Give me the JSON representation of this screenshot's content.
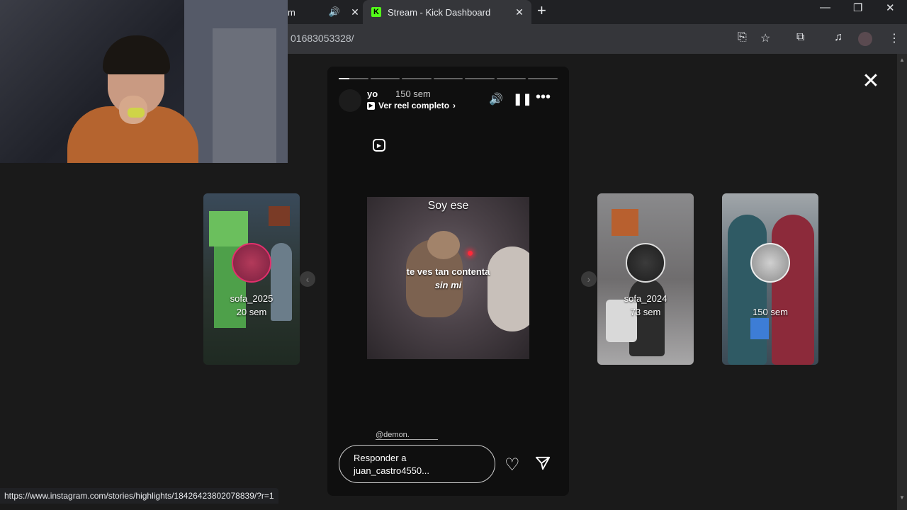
{
  "browser": {
    "tabs": [
      {
        "title": "m",
        "active": false
      },
      {
        "title": "Stream - Kick Dashboard",
        "active": true
      }
    ],
    "url": "01683053328/",
    "status_url": "https://www.instagram.com/stories/highlights/18426423802078839/?r=1"
  },
  "story": {
    "username": "yo",
    "time": "150 sem",
    "reel_link": "Ver reel completo",
    "media_text_top": "Soy ese",
    "media_text_line1": "te ves tan contenta",
    "media_text_line2": "sin mi",
    "mention": "@demon.",
    "reply_line1": "Responder a",
    "reply_line2": "juan_castro4550..."
  },
  "previews": [
    {
      "name": "sofa_2025",
      "time": "20 sem"
    },
    {
      "name": "sofa_2024",
      "time": "73 sem"
    },
    {
      "name": "",
      "time": "150 sem"
    }
  ],
  "colors": {
    "kick_green": "#53fc18",
    "story_ring": "#e1306c",
    "background": "#1a1a1a"
  }
}
